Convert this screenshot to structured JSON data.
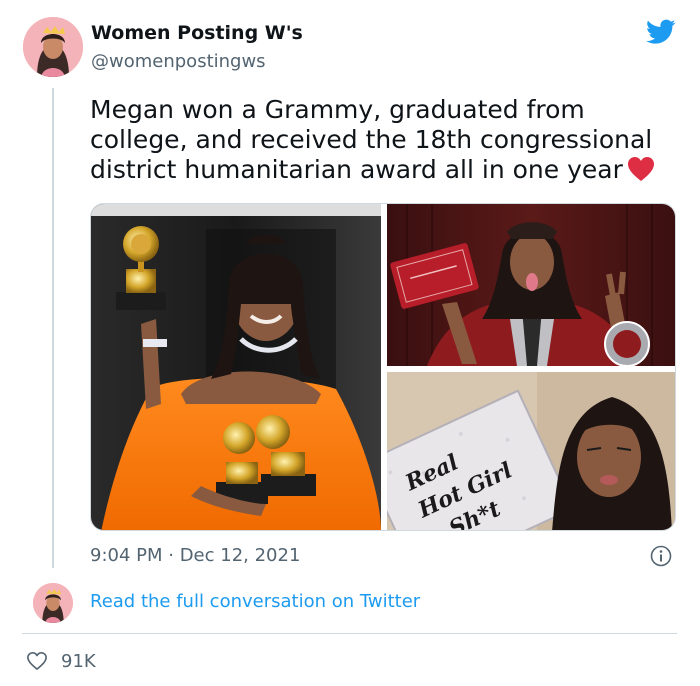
{
  "tweet": {
    "author_name": "Women Posting W's",
    "author_handle": "@womenpostingws",
    "text": "Megan won a Grammy, graduated from college, and received the 18th congressional district humanitarian award all in one year",
    "text_emoji": "red-heart-emoji",
    "timestamp": "9:04 PM · Dec 12, 2021",
    "read_link": "Read the full conversation on Twitter",
    "like_count": "91K"
  },
  "photos": {
    "grad_cap_text_line1": "Real",
    "grad_cap_text_line2": "Hot Girl",
    "grad_cap_text_line3": "Sh*t"
  },
  "icons": {
    "platform": "twitter-bird-icon",
    "info": "info-icon",
    "like": "heart-outline-icon"
  },
  "colors": {
    "link": "#1d9bf0",
    "muted": "#536471",
    "heart": "#e0245e",
    "twitter_blue": "#1d9bf0"
  }
}
